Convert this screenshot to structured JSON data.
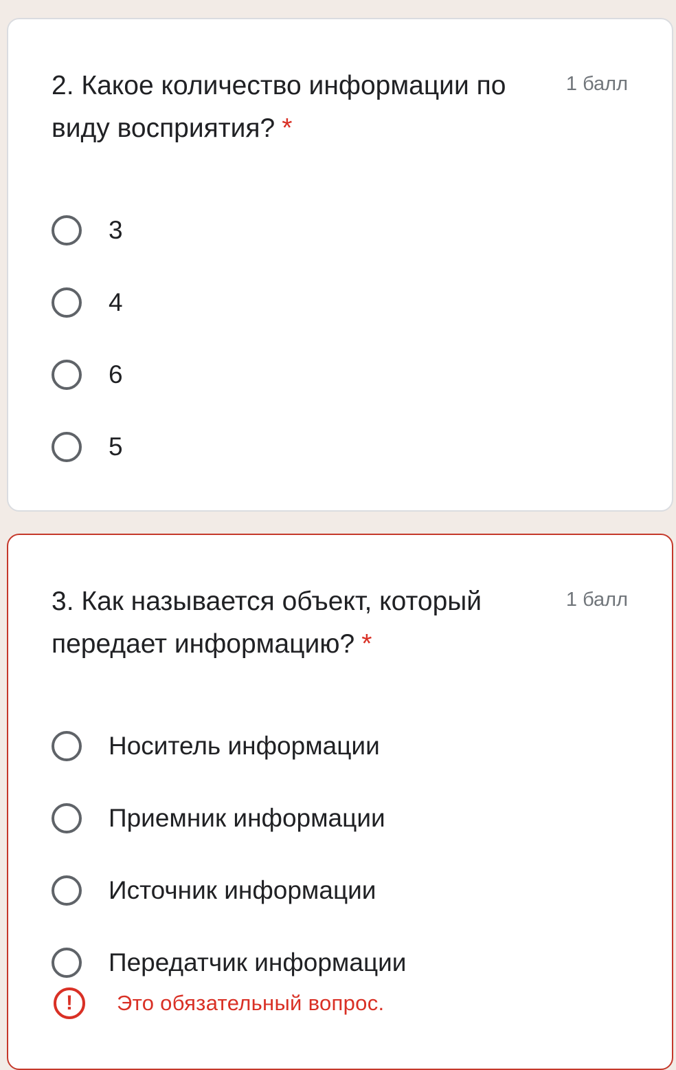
{
  "questions": [
    {
      "title": "2. Какое количество информации по виду восприятия?",
      "required_mark": "*",
      "points": "1 балл",
      "options": [
        "3",
        "4",
        "6",
        "5"
      ]
    },
    {
      "title": "3. Как называется объект, который передает информацию?",
      "required_mark": "*",
      "points": "1 балл",
      "options": [
        "Носитель информации",
        "Приемник информации",
        "Источник информации",
        "Передатчик информации"
      ],
      "error_text": "Это обязательный вопрос."
    }
  ],
  "colors": {
    "page_background": "#f2ebe6",
    "card_background": "#ffffff",
    "error": "#d93025",
    "radio_border": "#5f6368",
    "muted_text": "#70757a"
  },
  "icons": {
    "error": "exclamation-circle-icon"
  }
}
